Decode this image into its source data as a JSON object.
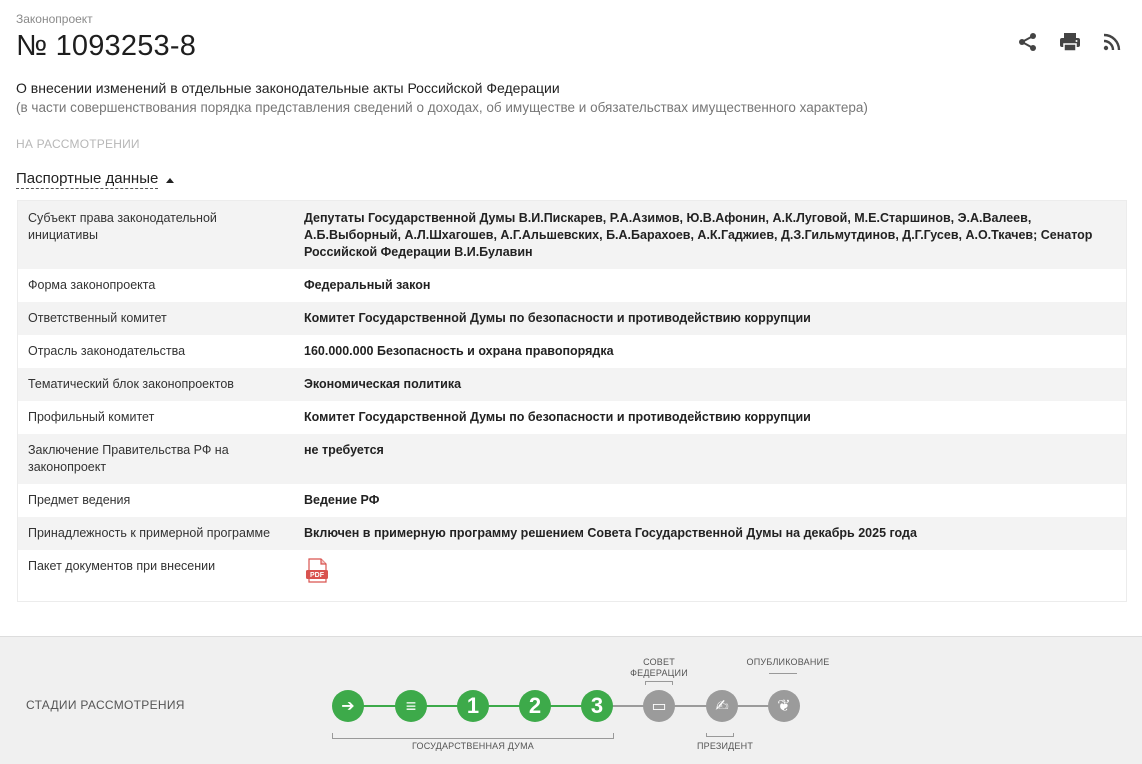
{
  "header": {
    "kicker": "Законопроект",
    "bill_number": "№ 1093253-8",
    "title": "О внесении изменений в отдельные законодательные акты Российской Федерации",
    "subtitle": "(в части совершенствования порядка представления сведений о доходах, об имуществе и обязательствах имущественного характера)",
    "status": "НА РАССМОТРЕНИИ",
    "actions": [
      {
        "icon": "share-icon"
      },
      {
        "icon": "print-icon"
      },
      {
        "icon": "rss-icon"
      }
    ]
  },
  "passport": {
    "toggle_label": "Паспортные данные",
    "rows": [
      {
        "key": "Субъект права законодательной инициативы",
        "value": "Депутаты Государственной Думы В.И.Пискарев, Р.А.Азимов, Ю.В.Афонин, А.К.Луговой, М.Е.Старшинов, Э.А.Валеев, А.Б.Выборный, А.Л.Шхагошев, А.Г.Альшевских, Б.А.Барахоев, А.К.Гаджиев, Д.З.Гильмутдинов, Д.Г.Гусев, А.О.Ткачев; Сенатор Российской Федерации В.И.Булавин"
      },
      {
        "key": "Форма законопроекта",
        "value": "Федеральный закон"
      },
      {
        "key": "Ответственный комитет",
        "value": "Комитет Государственной Думы по безопасности и противодействию коррупции"
      },
      {
        "key": "Отрасль законодательства",
        "value": "160.000.000 Безопасность и охрана правопорядка"
      },
      {
        "key": "Тематический блок законопроектов",
        "value": "Экономическая политика"
      },
      {
        "key": "Профильный комитет",
        "value": "Комитет Государственной Думы по безопасности и противодействию коррупции"
      },
      {
        "key": "Заключение Правительства РФ на законопроект",
        "value": "не требуется"
      },
      {
        "key": "Предмет ведения",
        "value": "Ведение РФ"
      },
      {
        "key": "Принадлежность к примерной программе",
        "value": "Включен в примерную программу решением Совета Государственной Думы на декабрь 2025 года"
      },
      {
        "key": "Пакет документов при внесении",
        "value": ""
      }
    ],
    "pdf_label": "PDF"
  },
  "stages": {
    "label": "СТАДИИ РАССМОТРЕНИЯ",
    "items": [
      {
        "symbol": "➔",
        "state": "done",
        "icon": "arrow-right-icon"
      },
      {
        "symbol": "≡",
        "state": "done",
        "icon": "document-icon"
      },
      {
        "symbol": "1",
        "state": "done",
        "icon": "reading-1-icon"
      },
      {
        "symbol": "2",
        "state": "done",
        "icon": "reading-2-icon"
      },
      {
        "symbol": "3",
        "state": "done",
        "icon": "reading-3-icon"
      },
      {
        "symbol": "▭",
        "state": "todo",
        "icon": "federation-council-icon"
      },
      {
        "symbol": "✍",
        "state": "todo",
        "icon": "president-sign-icon"
      },
      {
        "symbol": "❦",
        "state": "todo",
        "icon": "emblem-icon"
      }
    ],
    "captions": {
      "duma": "ГОСУДАРСТВЕННАЯ ДУМА",
      "council_1": "СОВЕТ",
      "council_2": "ФЕДЕРАЦИИ",
      "president": "ПРЕЗИДЕНТ",
      "publication": "ОПУБЛИКОВАНИЕ"
    },
    "colors": {
      "done": "#3daa4a",
      "todo": "#9b9b9b"
    }
  }
}
